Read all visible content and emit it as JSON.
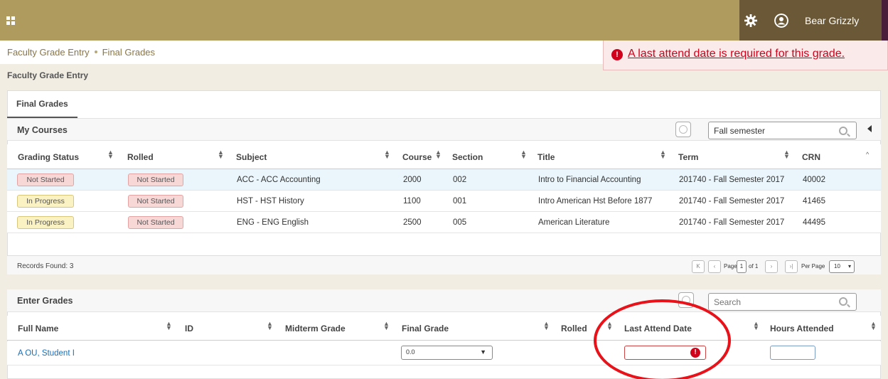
{
  "header": {
    "username": "Bear Grizzly",
    "colors": {
      "topbar": "#b09b5f",
      "user_zone": "#6b5836"
    },
    "icons": [
      "apps-grid-icon",
      "gear-icon",
      "user-avatar-icon"
    ]
  },
  "breadcrumb": {
    "items": [
      "Faculty Grade Entry",
      "Final Grades"
    ]
  },
  "notification": {
    "message": "A last attend date is required for this grade.",
    "icon": "error-icon",
    "color": "#d0021b"
  },
  "page_title": "Faculty Grade Entry",
  "tabs": [
    {
      "label": "Final Grades",
      "active": true
    }
  ],
  "my_courses": {
    "title": "My Courses",
    "search_value": "Fall semester",
    "columns": [
      "Grading Status",
      "Rolled",
      "Subject",
      "Course",
      "Section",
      "Title",
      "Term",
      "CRN"
    ],
    "rows": [
      {
        "grading_status": "Not Started",
        "rolled": "Not Started",
        "subject": "ACC - ACC Accounting",
        "course": "2000",
        "section": "002",
        "title": "Intro to Financial Accounting",
        "term": "201740 - Fall Semester 2017",
        "crn": "40002"
      },
      {
        "grading_status": "In Progress",
        "rolled": "Not Started",
        "subject": "HST - HST History",
        "course": "1100",
        "section": "001",
        "title": "Intro American Hst Before 1877",
        "term": "201740 - Fall Semester 2017",
        "crn": "41465"
      },
      {
        "grading_status": "In Progress",
        "rolled": "Not Started",
        "subject": "ENG - ENG English",
        "course": "2500",
        "section": "005",
        "title": "American Literature",
        "term": "201740 - Fall Semester 2017",
        "crn": "44495"
      }
    ],
    "records_found": "Records Found: 3",
    "pagination": {
      "page_label": "Page",
      "page": "1",
      "of_label": "of 1",
      "per_page_label": "Per Page",
      "per_page": "10"
    }
  },
  "enter_grades": {
    "title": "Enter Grades",
    "search_placeholder": "Search",
    "columns": [
      "Full Name",
      "ID",
      "Midterm Grade",
      "Final Grade",
      "Rolled",
      "Last Attend Date",
      "Hours Attended"
    ],
    "row": {
      "full_name": "A OU, Student I",
      "final_grade": "0.0"
    }
  }
}
